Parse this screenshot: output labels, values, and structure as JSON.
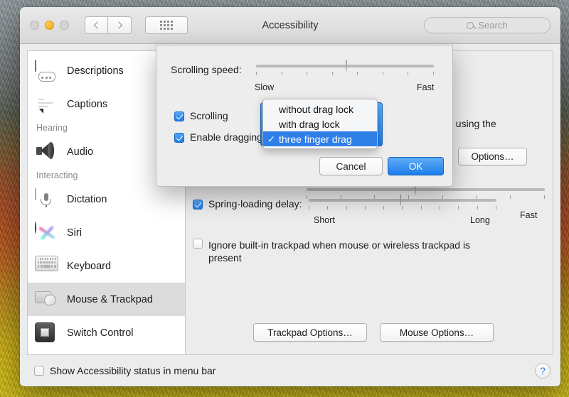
{
  "window": {
    "title": "Accessibility",
    "traffic_lights": [
      "close-inactive",
      "minimize-amber",
      "zoom-inactive"
    ],
    "nav_back": "‹",
    "nav_forward": "›",
    "grid_icon": "show-all-grid-icon"
  },
  "search": {
    "placeholder": "Search",
    "icon": "search-icon"
  },
  "sidebar": {
    "items": [
      {
        "type": "item",
        "label": "Descriptions",
        "icon": "descriptions-icon",
        "selected": false
      },
      {
        "type": "item",
        "label": "Captions",
        "icon": "captions-icon",
        "selected": false
      },
      {
        "type": "section",
        "label": "Hearing"
      },
      {
        "type": "item",
        "label": "Audio",
        "icon": "audio-icon",
        "selected": false
      },
      {
        "type": "section",
        "label": "Interacting"
      },
      {
        "type": "item",
        "label": "Dictation",
        "icon": "dictation-icon",
        "selected": false
      },
      {
        "type": "item",
        "label": "Siri",
        "icon": "siri-icon",
        "selected": false
      },
      {
        "type": "item",
        "label": "Keyboard",
        "icon": "keyboard-icon",
        "selected": false
      },
      {
        "type": "item",
        "label": "Mouse & Trackpad",
        "icon": "mouse-trackpad-icon",
        "selected": true
      },
      {
        "type": "item",
        "label": "Switch Control",
        "icon": "switch-control-icon",
        "selected": false
      }
    ]
  },
  "detail": {
    "intro_text_fragment": "ntrolled using the",
    "options_button": "Options…",
    "background_slider_fast_label": "Fast",
    "spring_loading": {
      "label": "Spring-loading delay:",
      "checked": true,
      "min_label": "Short",
      "max_label": "Long",
      "value_percent": 52
    },
    "ignore_trackpad": {
      "label": "Ignore built-in trackpad when mouse or wireless trackpad is present",
      "checked": false
    },
    "trackpad_options_button": "Trackpad Options…",
    "mouse_options_button": "Mouse Options…"
  },
  "modal": {
    "scrolling_speed": {
      "label": "Scrolling speed:",
      "min_label": "Slow",
      "max_label": "Fast",
      "value_percent": 54,
      "focused": true,
      "tick_count": 8
    },
    "scrolling_checkbox": {
      "label": "Scrolling",
      "checked": true
    },
    "enable_dragging_checkbox": {
      "label": "Enable dragging",
      "checked": true
    },
    "dropdown": {
      "selected_value": "three finger drag",
      "options": [
        {
          "label": "without drag lock",
          "selected": false
        },
        {
          "label": "with drag lock",
          "selected": false
        },
        {
          "label": "three finger drag",
          "selected": true
        }
      ],
      "check_glyph": "✓"
    },
    "cancel_button": "Cancel",
    "ok_button": "OK"
  },
  "footer": {
    "show_status_checkbox": {
      "label": "Show Accessibility status in menu bar",
      "checked": false
    },
    "help_button": "?"
  },
  "colors": {
    "accent_blue": "#1a7ceb",
    "menu_highlight": "#2f7fe8",
    "window_bg": "#ececec",
    "sidebar_selected": "#dcdcdc"
  }
}
